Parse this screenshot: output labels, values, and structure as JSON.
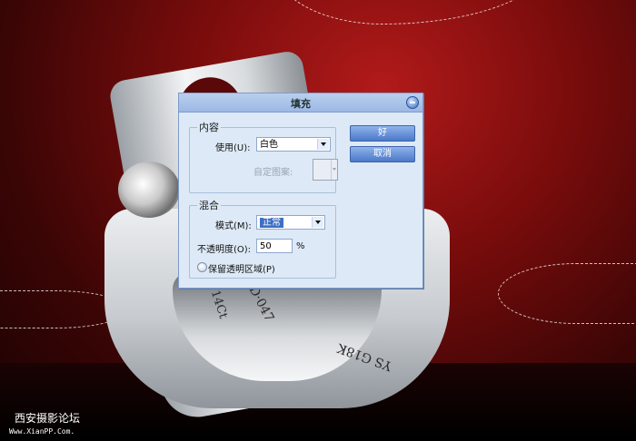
{
  "dialog": {
    "title": "填充",
    "contents": {
      "group_title": "内容",
      "use_label": "使用(U):",
      "use_value": "白色",
      "custom_pattern_label": "自定图案:"
    },
    "blending": {
      "group_title": "混合",
      "mode_label": "模式(M):",
      "mode_value": "正常",
      "opacity_label": "不透明度(O):",
      "opacity_value": "50",
      "opacity_unit": "%",
      "preserve_transparency_label": "保留透明区域(P)"
    },
    "buttons": {
      "ok": "好",
      "cancel": "取消"
    }
  },
  "ring_engravings": [
    "DD·047",
    "14Ct",
    "YS G18K"
  ],
  "watermark": {
    "site_name": "西安摄影论坛",
    "url": "Www.XianPP.Com."
  },
  "colors": {
    "background_red": "#7a0c0c",
    "dialog_bg": "#dde9f7",
    "button_blue": "#4b79c9",
    "selected_blue": "#3d6fc4"
  }
}
